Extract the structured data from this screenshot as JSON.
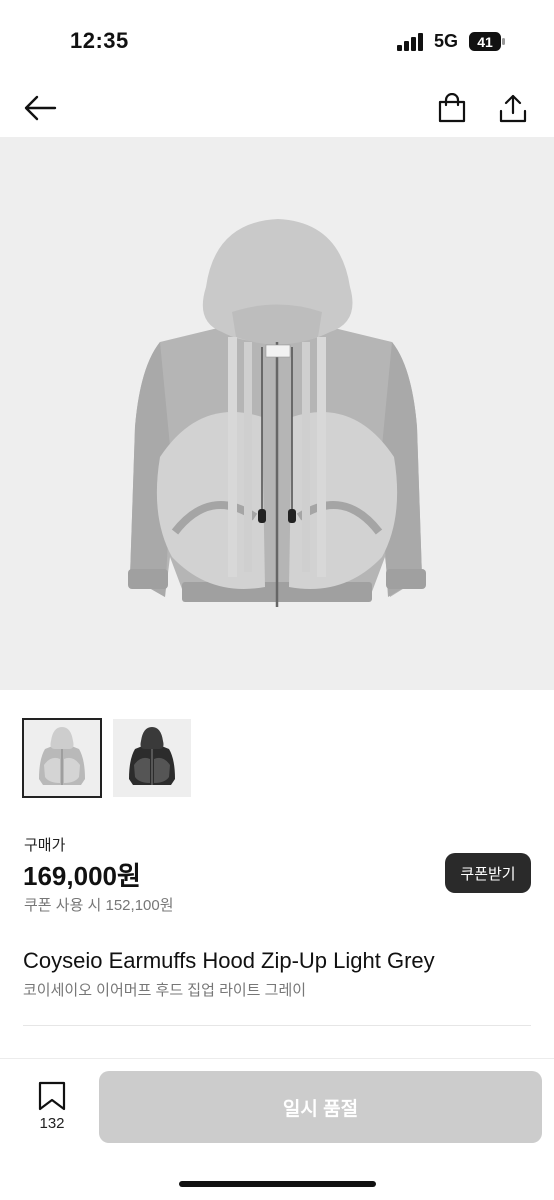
{
  "status": {
    "time": "12:35",
    "network": "5G",
    "battery": "41"
  },
  "nav": {
    "back_icon": "arrow-left-icon",
    "bag_icon": "shopping-bag-icon",
    "share_icon": "share-icon"
  },
  "gallery": {
    "images": [
      "light-grey-hoodie",
      "black-hoodie"
    ],
    "selected_index": 0
  },
  "price": {
    "label": "구매가",
    "amount": "169,000원",
    "coupon_text": "쿠폰 사용 시 152,100원",
    "coupon_button": "쿠폰받기"
  },
  "product": {
    "name_en": "Coyseio Earmuffs Hood Zip-Up Light Grey",
    "name_ko": "코이세이오 이어머프 후드 집업 라이트 그레이"
  },
  "bottom": {
    "wish_count": "132",
    "buy_button": "일시 품절"
  },
  "colors": {
    "accent_dark": "#2a2a2a",
    "disabled": "#cccccc",
    "hero_bg": "#eeeeee",
    "hoodie_light": "#b5b5b5",
    "hoodie_dark": "#2c2c2c"
  }
}
